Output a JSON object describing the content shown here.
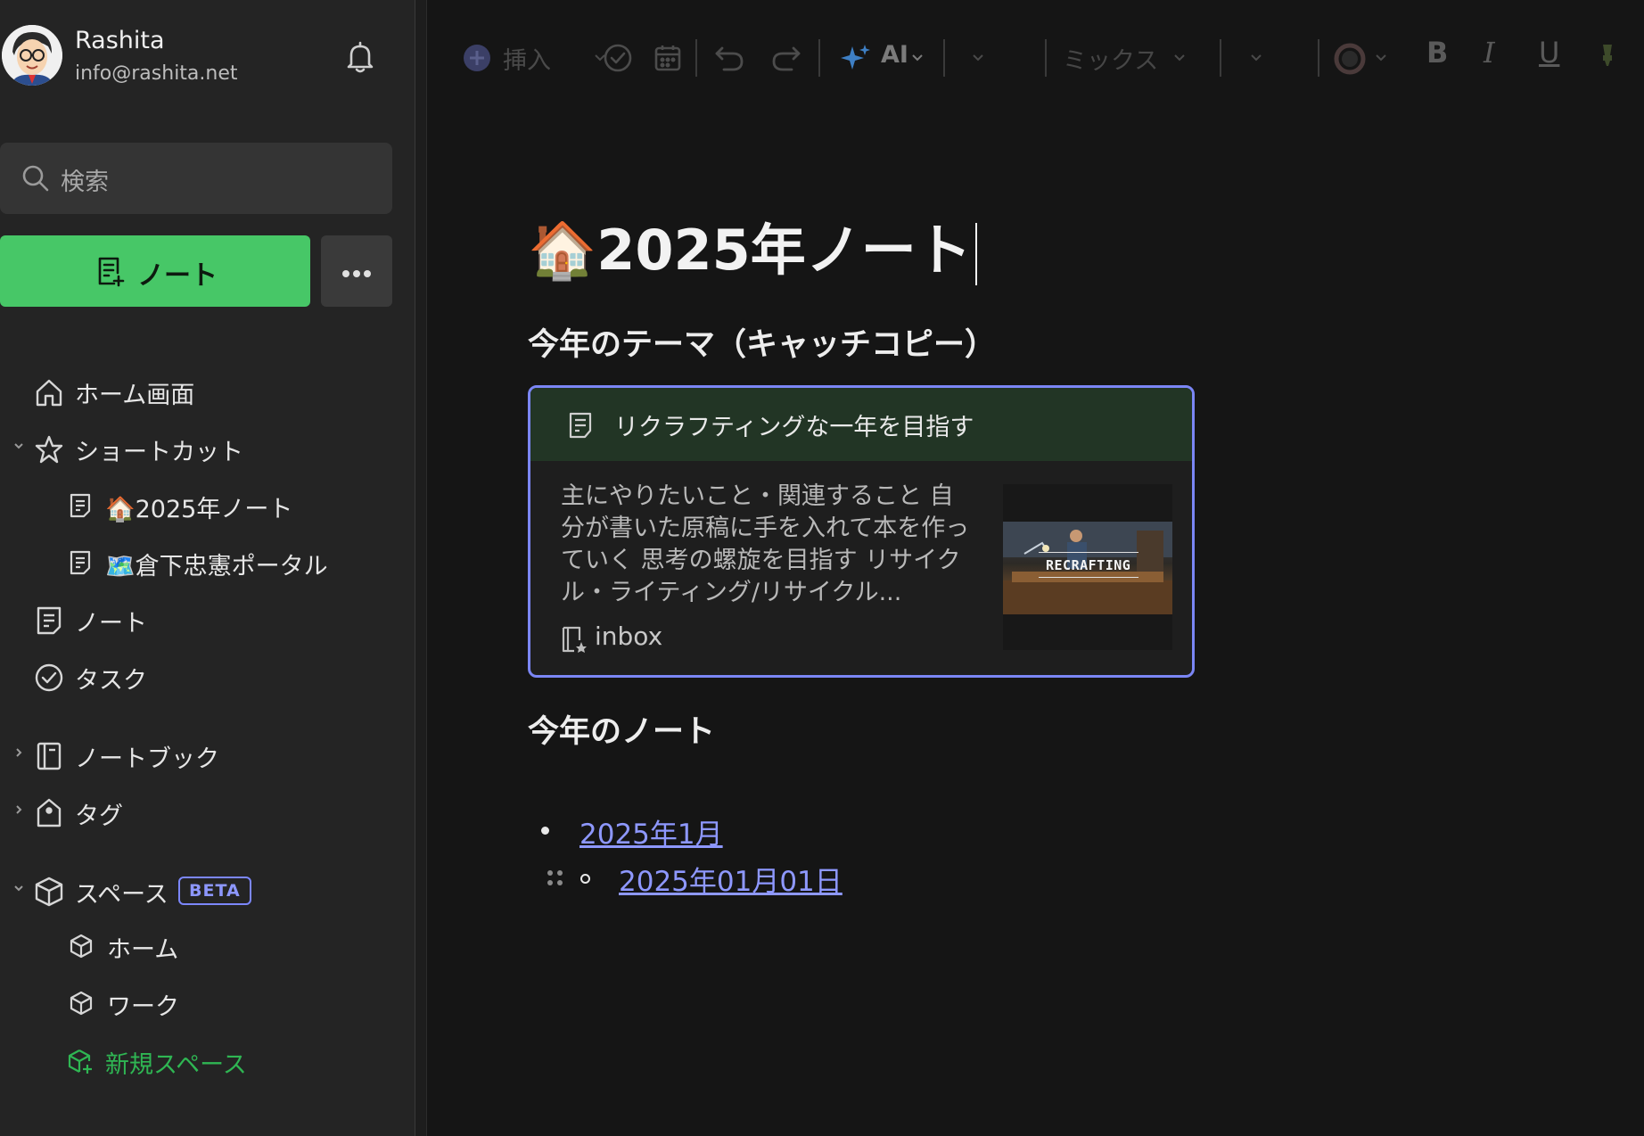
{
  "user": {
    "name": "Rashita",
    "email": "info@rashita.net"
  },
  "sidebar": {
    "search_placeholder": "検索",
    "new_note_label": "ノート",
    "items": [
      {
        "label": "ホーム画面",
        "icon": "home-icon"
      },
      {
        "label": "ショートカット",
        "icon": "star-icon",
        "expanded": true
      },
      {
        "label": "🏠2025年ノート",
        "icon": "note-icon"
      },
      {
        "label": "🗺️倉下忠憲ポータル",
        "icon": "note-icon"
      },
      {
        "label": "ノート",
        "icon": "note-icon"
      },
      {
        "label": "タスク",
        "icon": "check-circle-icon"
      },
      {
        "label": "ノートブック",
        "icon": "notebook-icon",
        "expanded": false
      },
      {
        "label": "タグ",
        "icon": "tag-icon",
        "expanded": false
      },
      {
        "label": "スペース",
        "icon": "cube-icon",
        "expanded": true,
        "badge": "BETA"
      },
      {
        "label": "ホーム",
        "icon": "cube-icon"
      },
      {
        "label": "ワーク",
        "icon": "cube-icon"
      },
      {
        "label": "新規スペース",
        "icon": "cube-plus-icon",
        "color": "#2fb653"
      }
    ]
  },
  "toolbar": {
    "insert_label": "挿入",
    "ai_label": "AI",
    "font_label": "ミックス",
    "bold_label": "B",
    "italic_label": "I",
    "underline_label": "U"
  },
  "note": {
    "title": "🏠2025年ノート",
    "section1_heading": "今年のテーマ（キャッチコピー）",
    "card": {
      "title": "リクラフティングな一年を目指す",
      "excerpt": "主にやりたいこと・関連すること 自分が書いた原稿に手を入れて本を作っていく 思考の螺旋を目指す リサイクル・ライティング/リサイクル...",
      "notebook": "inbox",
      "thumbnail_text": "RECRAFTING"
    },
    "section2_heading": "今年のノート",
    "links": [
      {
        "text": "2025年1月",
        "level": 1
      },
      {
        "text": "2025年01月01日",
        "level": 2
      }
    ]
  },
  "colors": {
    "accent_green": "#47c767",
    "link": "#8e98ff",
    "card_border": "#7b86f5",
    "card_header": "#223525"
  }
}
